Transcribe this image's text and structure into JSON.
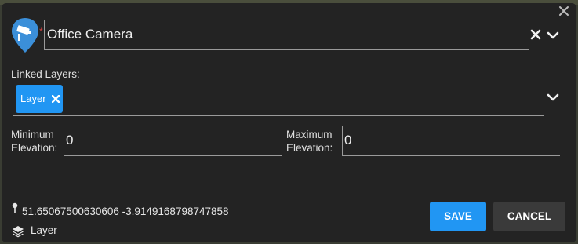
{
  "dialog": {
    "name_value": "Office Camera",
    "required_mark": "*",
    "linked_layers_label": "Linked Layers:",
    "linked_layers": [
      {
        "label": "Layer"
      }
    ],
    "min_elevation_label_line1": "Minimum",
    "min_elevation_label_line2": "Elevation:",
    "min_elevation_value": "0",
    "max_elevation_label_line1": "Maximum",
    "max_elevation_label_line2": "Elevation:",
    "max_elevation_value": "0",
    "coordinates": "51.65067500630606 -3.9149168798747858",
    "layer_name": "Layer",
    "save_label": "SAVE",
    "cancel_label": "CANCEL"
  },
  "colors": {
    "accent": "#2196f3",
    "dialog_bg": "#232323",
    "required": "#d04040",
    "marker": "#3b8fd9"
  },
  "icons": [
    "close-icon",
    "camera-marker-icon",
    "clear-icon",
    "chevron-down-icon",
    "pin-icon",
    "layers-icon"
  ]
}
